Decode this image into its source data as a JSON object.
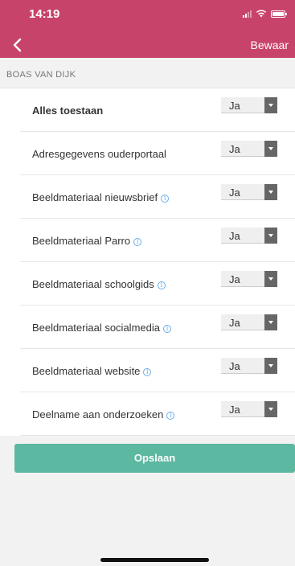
{
  "status_bar": {
    "time": "14:19"
  },
  "header": {
    "save_label": "Bewaar"
  },
  "section": {
    "title": "BOAS VAN DIJK"
  },
  "permissions": [
    {
      "label": "Alles toestaan",
      "value": "Ja",
      "bold": true,
      "info": false
    },
    {
      "label": "Adresgegevens ouderportaal",
      "value": "Ja",
      "bold": false,
      "info": false
    },
    {
      "label": "Beeldmateriaal nieuwsbrief",
      "value": "Ja",
      "bold": false,
      "info": true
    },
    {
      "label": "Beeldmateriaal Parro",
      "value": "Ja",
      "bold": false,
      "info": true
    },
    {
      "label": "Beeldmateriaal schoolgids",
      "value": "Ja",
      "bold": false,
      "info": true
    },
    {
      "label": "Beeldmateriaal socialmedia",
      "value": "Ja",
      "bold": false,
      "info": true
    },
    {
      "label": "Beeldmateriaal website",
      "value": "Ja",
      "bold": false,
      "info": true
    },
    {
      "label": "Deelname aan onderzoeken",
      "value": "Ja",
      "bold": false,
      "info": true
    }
  ],
  "actions": {
    "submit_label": "Opslaan"
  },
  "colors": {
    "header": "#c8436a",
    "button": "#5cb8a1",
    "info": "#6aaee8"
  },
  "icons": {
    "back": "chevron-left-icon",
    "info": "info-icon",
    "dropdown": "triangle-down-icon"
  }
}
